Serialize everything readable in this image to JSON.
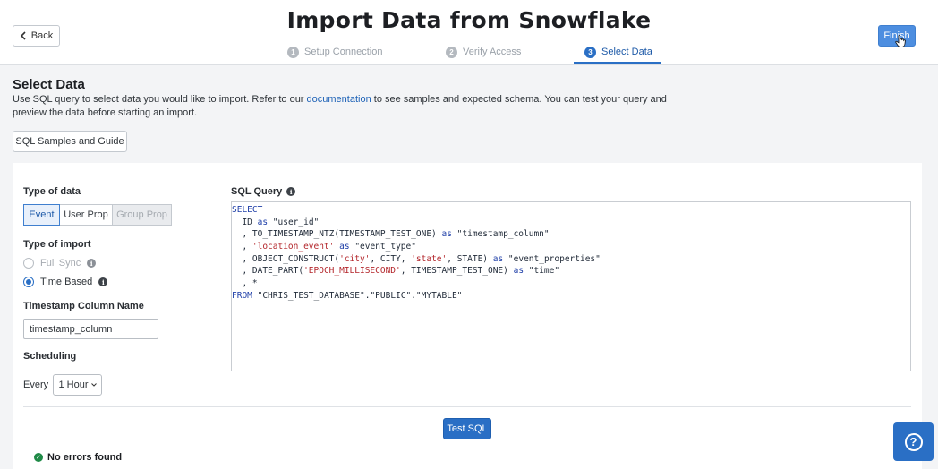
{
  "header": {
    "back_label": "Back",
    "title": "Import Data from Snowflake",
    "finish_label": "Finish",
    "steps": [
      {
        "number": "1",
        "label": "Setup Connection",
        "state": "complete"
      },
      {
        "number": "2",
        "label": "Verify Access",
        "state": "complete"
      },
      {
        "number": "3",
        "label": "Select Data",
        "state": "active"
      }
    ]
  },
  "section": {
    "title": "Select Data",
    "desc_before": "Use SQL query to select data you would like to import. Refer to our ",
    "desc_link": "documentation",
    "desc_after": " to see samples and expected schema. You can test your query and preview the data before starting an import.",
    "samples_button": "SQL Samples and Guide"
  },
  "form": {
    "type_of_data_label": "Type of data",
    "type_of_data_options": [
      {
        "label": "Event",
        "state": "selected"
      },
      {
        "label": "User Prop",
        "state": "default"
      },
      {
        "label": "Group Prop",
        "state": "disabled"
      }
    ],
    "type_of_import_label": "Type of import",
    "import_options": [
      {
        "label": "Full Sync",
        "selected": false,
        "disabled": true
      },
      {
        "label": "Time Based",
        "selected": true,
        "disabled": false
      }
    ],
    "timestamp_label": "Timestamp Column Name",
    "timestamp_value": "timestamp_column",
    "scheduling_label": "Scheduling",
    "every_label": "Every",
    "interval_value": "1 Hour"
  },
  "sql": {
    "label": "SQL Query",
    "lines": [
      [
        {
          "t": "SELECT",
          "c": "kw"
        }
      ],
      [
        {
          "t": "  ID "
        },
        {
          "t": "as",
          "c": "kw"
        },
        {
          "t": " \"user_id\""
        }
      ],
      [
        {
          "t": "  , TO_TIMESTAMP_NTZ(TIMESTAMP_TEST_ONE) "
        },
        {
          "t": "as",
          "c": "kw"
        },
        {
          "t": " \"timestamp_column\""
        }
      ],
      [
        {
          "t": "  , "
        },
        {
          "t": "'location_event'",
          "c": "str"
        },
        {
          "t": " "
        },
        {
          "t": "as",
          "c": "kw"
        },
        {
          "t": " \"event_type\""
        }
      ],
      [
        {
          "t": "  , OBJECT_CONSTRUCT("
        },
        {
          "t": "'city'",
          "c": "str"
        },
        {
          "t": ", CITY, "
        },
        {
          "t": "'state'",
          "c": "str"
        },
        {
          "t": ", STATE) "
        },
        {
          "t": "as",
          "c": "kw"
        },
        {
          "t": " \"event_properties\""
        }
      ],
      [
        {
          "t": "  , DATE_PART("
        },
        {
          "t": "'EPOCH_MILLISECOND'",
          "c": "str"
        },
        {
          "t": ", TIMESTAMP_TEST_ONE) "
        },
        {
          "t": "as",
          "c": "kw"
        },
        {
          "t": " \"time\""
        }
      ],
      [
        {
          "t": "  , *"
        }
      ],
      [
        {
          "t": "FROM",
          "c": "kw"
        },
        {
          "t": " \"CHRIS_TEST_DATABASE\".\"PUBLIC\".\"MYTABLE\""
        }
      ]
    ]
  },
  "actions": {
    "test_label": "Test SQL",
    "status": "No errors found"
  },
  "help": {
    "glyph": "?"
  }
}
